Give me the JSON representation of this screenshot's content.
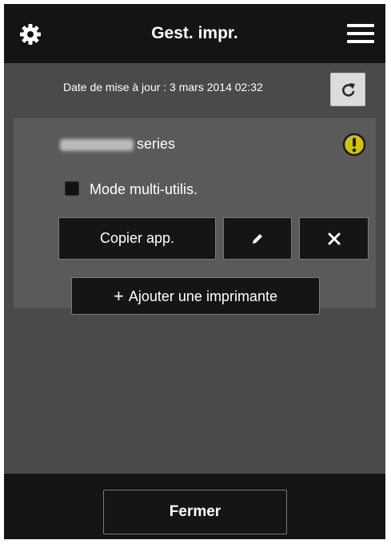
{
  "header": {
    "title": "Gest. impr.",
    "settings_icon": "gear-icon",
    "menu_icon": "hamburger-menu-icon"
  },
  "update": {
    "text": "Date de mise à jour : 3 mars 2014 02:32",
    "refresh_icon": "refresh-icon"
  },
  "printer": {
    "name_suffix": "series",
    "status_icon": "warning-icon",
    "status_color": "#d4c20a",
    "multi_user_label": "Mode multi-utilis.",
    "multi_user_checked": false,
    "copy_label": "Copier app.",
    "edit_icon": "pencil-icon",
    "delete_icon": "close-icon"
  },
  "add_printer": {
    "icon": "+",
    "label": "Ajouter une imprimante"
  },
  "footer": {
    "close_label": "Fermer"
  }
}
